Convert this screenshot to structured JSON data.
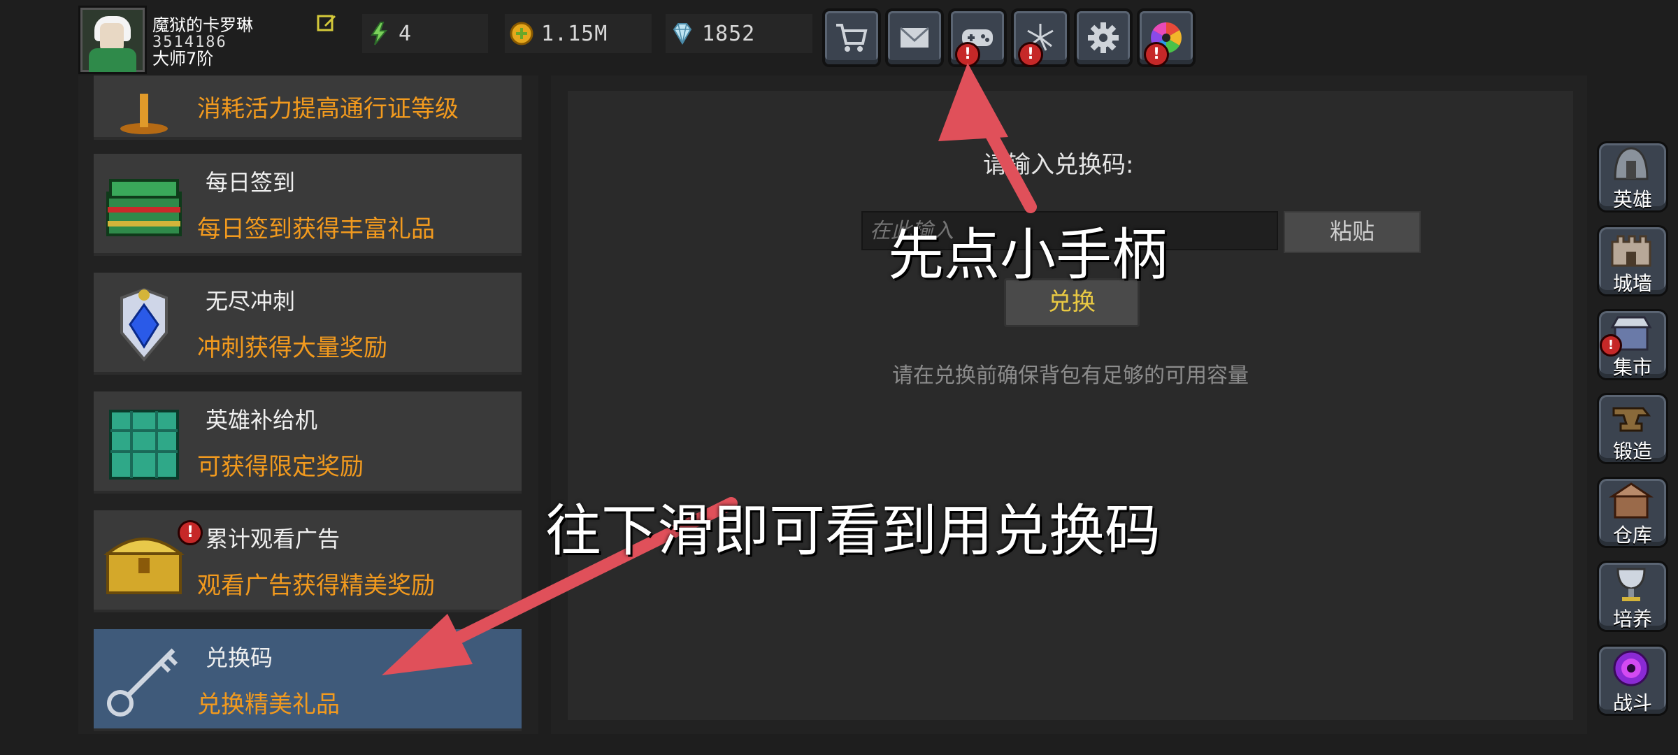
{
  "player": {
    "name": "魔狱的卡罗琳",
    "id": "3514186",
    "rank": "大师7阶"
  },
  "resources": {
    "energy": "4",
    "gold": "1.15M",
    "diamond": "1852"
  },
  "toolbar": [
    {
      "icon": "cart-icon",
      "alert": false
    },
    {
      "icon": "mail-icon",
      "alert": false
    },
    {
      "icon": "gamepad-icon",
      "alert": true
    },
    {
      "icon": "fireworks-icon",
      "alert": true
    },
    {
      "icon": "gear-icon",
      "alert": false
    },
    {
      "icon": "color-wheel-icon",
      "alert": true
    }
  ],
  "list": [
    {
      "title": "",
      "desc": "消耗活力提高通行证等级",
      "icon": "trophy-icon"
    },
    {
      "title": "每日签到",
      "desc": "每日签到获得丰富礼品",
      "icon": "chest-green-icon"
    },
    {
      "title": "无尽冲刺",
      "desc": "冲刺获得大量奖励",
      "icon": "crystal-shield-icon"
    },
    {
      "title": "英雄补给机",
      "desc": "可获得限定奖励",
      "icon": "supply-box-icon"
    },
    {
      "title": "累计观看广告",
      "desc": "观看广告获得精美奖励",
      "icon": "golden-chest-icon",
      "alert": true
    },
    {
      "title": "兑换码",
      "desc": "兑换精美礼品",
      "icon": "key-icon",
      "selected": true
    }
  ],
  "redeem": {
    "prompt": "请输入兑换码:",
    "placeholder": "在此输入",
    "paste_label": "粘贴",
    "redeem_label": "兑换",
    "note": "请在兑换前确保背包有足够的可用容量"
  },
  "sidebar": [
    {
      "label": "英雄",
      "icon": "helmet-icon"
    },
    {
      "label": "城墙",
      "icon": "castle-wall-icon"
    },
    {
      "label": "集市",
      "icon": "market-icon",
      "alert": true
    },
    {
      "label": "锻造",
      "icon": "anvil-icon"
    },
    {
      "label": "仓库",
      "icon": "warehouse-icon"
    },
    {
      "label": "培养",
      "icon": "chalice-icon"
    },
    {
      "label": "战斗",
      "icon": "portal-icon"
    }
  ],
  "annotations": {
    "tap_gamepad": "先点小手柄",
    "scroll_down": "往下滑即可看到用兑换码"
  },
  "colors": {
    "accent_orange": "#f29a1e",
    "redeem_yellow": "#e9c943",
    "selected_row": "#3f5a7a",
    "arrow_red": "#e0505a",
    "alert_red": "#c62828"
  }
}
